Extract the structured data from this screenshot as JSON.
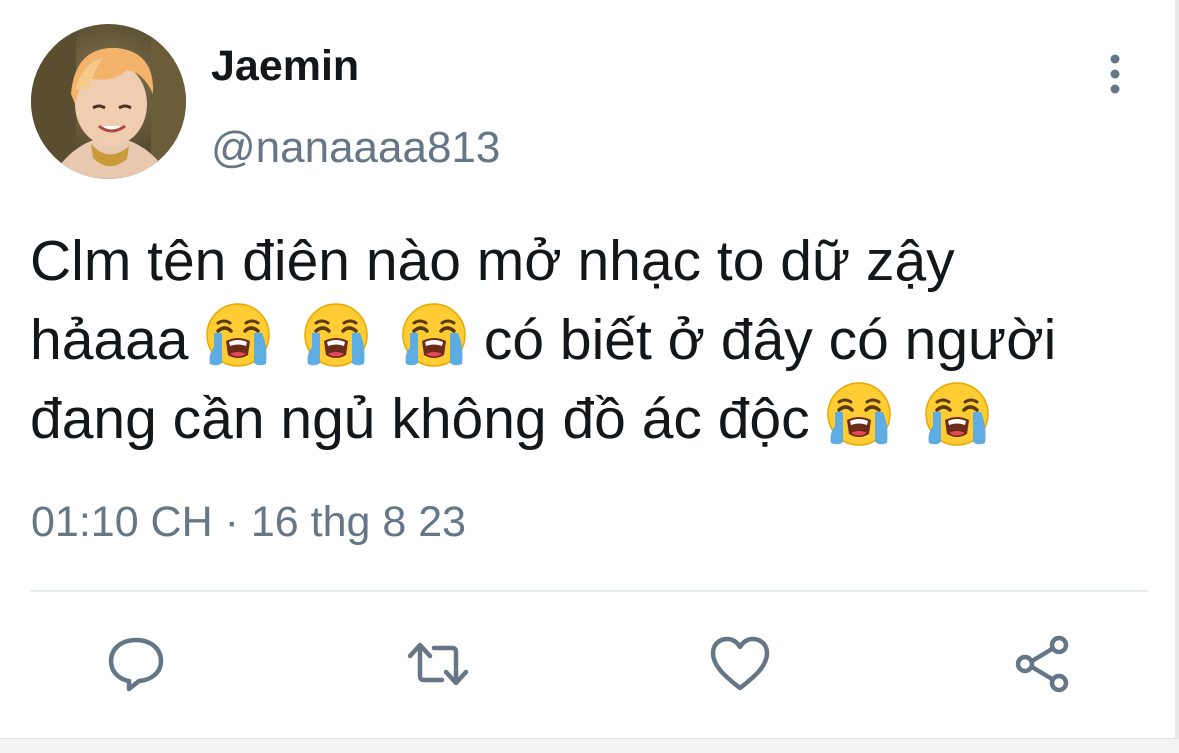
{
  "user": {
    "display_name": "Jaemin",
    "handle": "@nanaaaa813"
  },
  "tweet": {
    "lines": [
      {
        "text": "Clm tên điên nào mở nhạc to dữ zậy",
        "emoji_after": 0
      },
      {
        "text_before": "hảaaa",
        "emoji_count": 3,
        "text_after": "có biết ở đây có người"
      },
      {
        "text": "đang cần ngủ không đồ ác độc",
        "emoji_after": 2
      }
    ],
    "emoji_icon": "loudly-crying-face-emoji",
    "timestamp": "01:10 CH · 16 thg 8 23"
  },
  "actions": [
    {
      "name": "reply",
      "icon": "comment-bubble-icon"
    },
    {
      "name": "retweet",
      "icon": "retweet-arrows-icon"
    },
    {
      "name": "like",
      "icon": "heart-outline-icon"
    },
    {
      "name": "share",
      "icon": "share-nodes-icon"
    }
  ],
  "colors": {
    "primary_text": "#14171a",
    "secondary_text": "#657786",
    "icon_gray": "#657786",
    "divider": "#e6ecf0",
    "emoji_yellow": "#ffcc33",
    "tear_blue": "#5dade2"
  }
}
